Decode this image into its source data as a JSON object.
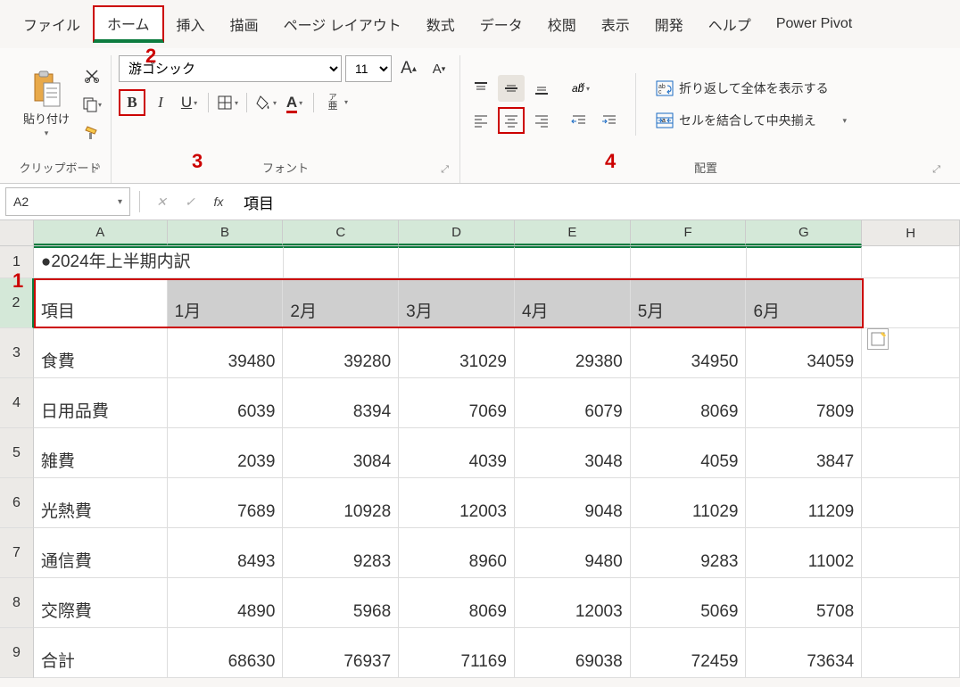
{
  "menu": {
    "items": [
      "ファイル",
      "ホーム",
      "挿入",
      "描画",
      "ページ レイアウト",
      "数式",
      "データ",
      "校閲",
      "表示",
      "開発",
      "ヘルプ",
      "Power Pivot"
    ],
    "active_index": 1
  },
  "ribbon": {
    "clipboard": {
      "paste": "貼り付け",
      "label": "クリップボード"
    },
    "font": {
      "name": "游ゴシック",
      "size": "11",
      "increase": "A",
      "decrease": "A",
      "bold": "B",
      "italic": "I",
      "underline": "U",
      "phonetic": "ア亜",
      "label": "フォント"
    },
    "alignment": {
      "wrap": "折り返して全体を表示する",
      "merge": "セルを結合して中央揃え",
      "label": "配置"
    }
  },
  "annotations": {
    "a1": "1",
    "a2": "2",
    "a3": "3",
    "a4": "4"
  },
  "formula": {
    "name_box": "A2",
    "value": "項目"
  },
  "columns": [
    "A",
    "B",
    "C",
    "D",
    "E",
    "F",
    "G",
    "H"
  ],
  "rows": {
    "r1": {
      "n": "1",
      "A": "●2024年上半期内訳"
    },
    "r2": {
      "n": "2",
      "A": "項目",
      "B": "1月",
      "C": "2月",
      "D": "3月",
      "E": "4月",
      "F": "5月",
      "G": "6月"
    },
    "r3": {
      "n": "3",
      "A": "食費",
      "B": "39480",
      "C": "39280",
      "D": "31029",
      "E": "29380",
      "F": "34950",
      "G": "34059"
    },
    "r4": {
      "n": "4",
      "A": "日用品費",
      "B": "6039",
      "C": "8394",
      "D": "7069",
      "E": "6079",
      "F": "8069",
      "G": "7809"
    },
    "r5": {
      "n": "5",
      "A": "雑費",
      "B": "2039",
      "C": "3084",
      "D": "4039",
      "E": "3048",
      "F": "4059",
      "G": "3847"
    },
    "r6": {
      "n": "6",
      "A": "光熱費",
      "B": "7689",
      "C": "10928",
      "D": "12003",
      "E": "9048",
      "F": "11029",
      "G": "11209"
    },
    "r7": {
      "n": "7",
      "A": "通信費",
      "B": "8493",
      "C": "9283",
      "D": "8960",
      "E": "9480",
      "F": "9283",
      "G": "11002"
    },
    "r8": {
      "n": "8",
      "A": "交際費",
      "B": "4890",
      "C": "5968",
      "D": "8069",
      "E": "12003",
      "F": "5069",
      "G": "5708"
    },
    "r9": {
      "n": "9",
      "A": "合計",
      "B": "68630",
      "C": "76937",
      "D": "71169",
      "E": "69038",
      "F": "72459",
      "G": "73634"
    }
  }
}
